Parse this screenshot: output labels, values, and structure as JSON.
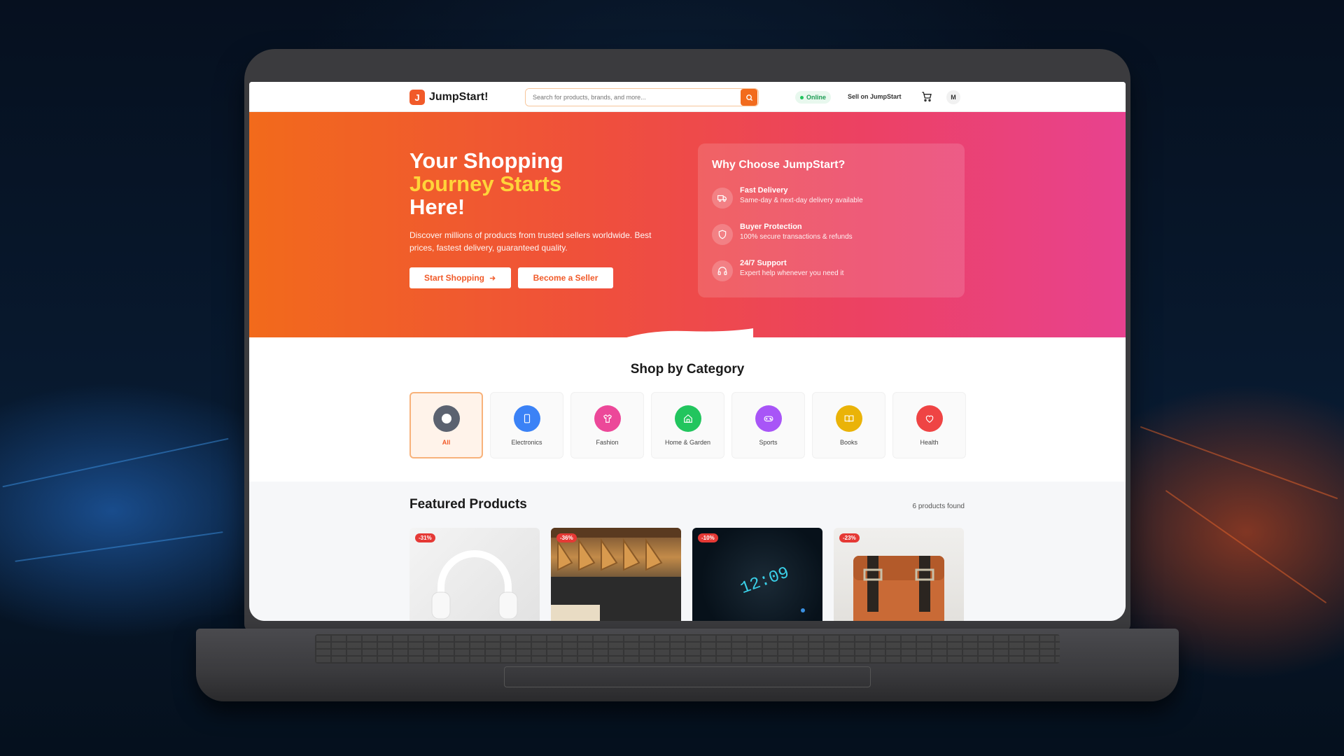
{
  "brand": {
    "logo_letter": "J",
    "name": "JumpStart!"
  },
  "nav": {
    "search_placeholder": "Search for products, brands, and more...",
    "status": "Online",
    "sell_link": "Sell on JumpStart",
    "avatar_initial": "M"
  },
  "hero": {
    "title_line1": "Your Shopping",
    "title_highlight": "Journey Starts",
    "title_line3": "Here!",
    "description": "Discover millions of products from trusted sellers worldwide. Best prices, fastest delivery, guaranteed quality.",
    "primary_button": "Start Shopping",
    "secondary_button": "Become a Seller"
  },
  "why": {
    "title": "Why Choose JumpStart?",
    "features": [
      {
        "icon": "truck-icon",
        "title": "Fast Delivery",
        "desc": "Same-day & next-day delivery available"
      },
      {
        "icon": "shield-icon",
        "title": "Buyer Protection",
        "desc": "100% secure transactions & refunds"
      },
      {
        "icon": "headphones-icon",
        "title": "24/7 Support",
        "desc": "Expert help whenever you need it"
      }
    ]
  },
  "categories": {
    "title": "Shop by Category",
    "items": [
      {
        "label": "All",
        "icon": "all-icon",
        "color": "#5b6270",
        "active": true
      },
      {
        "label": "Electronics",
        "icon": "phone-icon",
        "color": "#3b82f6"
      },
      {
        "label": "Fashion",
        "icon": "shirt-icon",
        "color": "#ec4899"
      },
      {
        "label": "Home & Garden",
        "icon": "home-icon",
        "color": "#22c55e"
      },
      {
        "label": "Sports",
        "icon": "gamepad-icon",
        "color": "#a855f7"
      },
      {
        "label": "Books",
        "icon": "book-icon",
        "color": "#eab308"
      },
      {
        "label": "Health",
        "icon": "heart-icon",
        "color": "#ef4444"
      }
    ]
  },
  "featured": {
    "title": "Featured Products",
    "count": "6 products found",
    "products": [
      {
        "discount": "-31%",
        "image": "white headphones"
      },
      {
        "discount": "-36%",
        "image": "clothes on hangers"
      },
      {
        "discount": "-10%",
        "image": "smartwatch"
      },
      {
        "discount": "-23%",
        "image": "leather bag"
      }
    ]
  },
  "colors": {
    "accent": "#f15a29",
    "highlight": "#ffd43a",
    "online": "#22c55e"
  }
}
